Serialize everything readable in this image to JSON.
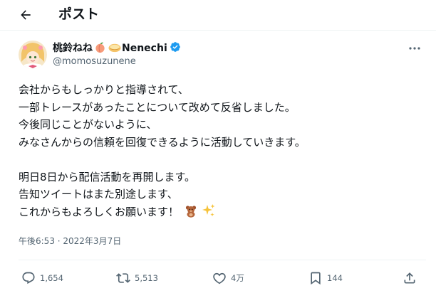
{
  "header": {
    "title": "ポスト"
  },
  "icons": {
    "back": "arrow-left-icon",
    "more": "more-horizontal-icon",
    "verified": "verified-badge-icon",
    "reply": "reply-icon",
    "retweet": "retweet-icon",
    "like": "heart-icon",
    "bookmark": "bookmark-icon",
    "share": "share-icon"
  },
  "user": {
    "display_name": "桃鈴ねね",
    "name_suffix": "Nenechi",
    "name_emojis": [
      "peach",
      "cream-bun"
    ],
    "handle": "@momosuzunene",
    "verified": true
  },
  "tweet": {
    "lines": [
      "会社からもしっかりと指導されて、",
      "一部トレースがあったことについて改めて反省しました。",
      "今後同じことがないように、",
      "みなさんからの信頼を回復できるように活動していきます。",
      "",
      "明日8日から配信活動を再開します。",
      "告知ツイートはまた別途します、",
      "これからもよろしくお願います！"
    ],
    "trailing_emojis": [
      "teddy-bear",
      "sparkles"
    ],
    "timestamp": "午後6:53 · 2022年3月7日"
  },
  "actions": {
    "reply_count": "1,654",
    "retweet_count": "5,513",
    "like_count": "4万",
    "bookmark_count": "144"
  },
  "colors": {
    "text": "#0f1419",
    "secondary": "#536471",
    "verified": "#1d9bf0",
    "divider": "#eff3f4"
  }
}
